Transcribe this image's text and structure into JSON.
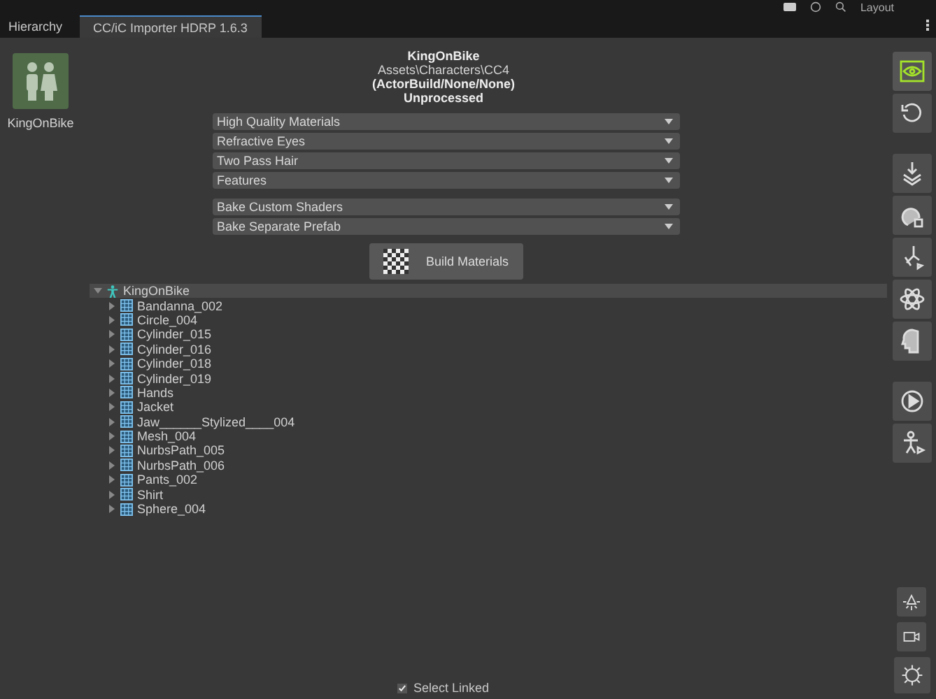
{
  "top_bar": {
    "layout_label": "Layout"
  },
  "tabs": [
    {
      "label": "Hierarchy",
      "selected": false
    },
    {
      "label": "CC/iC Importer HDRP 1.6.3",
      "selected": true
    }
  ],
  "character": {
    "name": "KingOnBike"
  },
  "header": {
    "title": "KingOnBike",
    "path": "Assets\\Characters\\CC4",
    "generation": "(ActorBuild/None/None)",
    "status": "Unprocessed"
  },
  "dropdowns": [
    {
      "value": "High Quality Materials"
    },
    {
      "value": "Refractive Eyes"
    },
    {
      "value": "Two Pass Hair"
    },
    {
      "value": "Features"
    }
  ],
  "bake_dropdowns": [
    {
      "value": "Bake Custom Shaders"
    },
    {
      "value": "Bake Separate Prefab"
    }
  ],
  "build_button": {
    "label": "Build Materials"
  },
  "tree": {
    "label": "KingOnBike",
    "expanded": true,
    "selected": true,
    "children": [
      {
        "label": "Bandanna_002",
        "expanded": false,
        "selected": false
      },
      {
        "label": "Circle_004",
        "expanded": false,
        "selected": false
      },
      {
        "label": "Cylinder_015",
        "expanded": false,
        "selected": false
      },
      {
        "label": "Cylinder_016",
        "expanded": false,
        "selected": false
      },
      {
        "label": "Cylinder_018",
        "expanded": false,
        "selected": false
      },
      {
        "label": "Cylinder_019",
        "expanded": false,
        "selected": false
      },
      {
        "label": "Hands",
        "expanded": false,
        "selected": false
      },
      {
        "label": "Jacket",
        "expanded": false,
        "selected": false
      },
      {
        "label": "Jaw______Stylized____004",
        "expanded": false,
        "selected": false
      },
      {
        "label": "Mesh_004",
        "expanded": false,
        "selected": false
      },
      {
        "label": "NurbsPath_005",
        "expanded": false,
        "selected": false
      },
      {
        "label": "NurbsPath_006",
        "expanded": false,
        "selected": false
      },
      {
        "label": "Pants_002",
        "expanded": false,
        "selected": false
      },
      {
        "label": "Shirt",
        "expanded": false,
        "selected": false
      },
      {
        "label": "Sphere_004",
        "expanded": false,
        "selected": false
      }
    ]
  },
  "side_tools": [
    {
      "selected": true
    },
    {
      "selected": false
    },
    {
      "selected": false
    },
    {
      "selected": false
    },
    {
      "selected": false
    },
    {
      "selected": false
    },
    {
      "selected": false
    },
    {
      "selected": false
    },
    {
      "selected": false
    }
  ],
  "scene_tools": [
    {
      "selected": false
    },
    {
      "selected": false
    },
    {
      "selected": false
    }
  ],
  "select_linked": {
    "label": "Select Linked",
    "checked": true
  }
}
